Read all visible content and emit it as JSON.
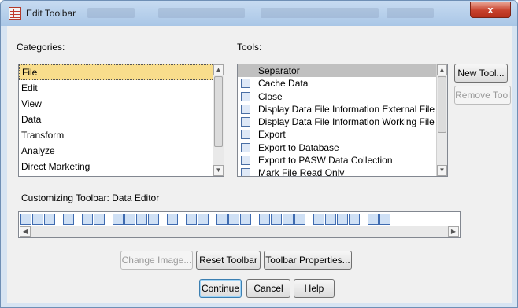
{
  "window": {
    "title": "Edit Toolbar",
    "close_label": "x"
  },
  "categories": {
    "label": "Categories:",
    "items": [
      "File",
      "Edit",
      "View",
      "Data",
      "Transform",
      "Analyze",
      "Direct Marketing"
    ],
    "selected": "File"
  },
  "tools": {
    "label": "Tools:",
    "items": [
      "Separator",
      "Cache Data",
      "Close",
      "Display Data File Information External File",
      "Display Data File Information Working File",
      "Export",
      "Export to Database",
      "Export to PASW Data Collection",
      "Mark File Read Only"
    ],
    "selected": "Separator"
  },
  "buttons": {
    "new_tool": "New Tool...",
    "remove_tool": "Remove Tool",
    "change_image": "Change Image...",
    "reset_toolbar": "Reset Toolbar",
    "toolbar_properties": "Toolbar Properties...",
    "continue": "Continue",
    "cancel": "Cancel",
    "help": "Help"
  },
  "customizing": {
    "label": "Customizing Toolbar:  Data Editor"
  },
  "colors": {
    "selection_highlight": "#f8dd8c",
    "tool_selection": "#c0c0c0",
    "close_button": "#c7412c"
  }
}
